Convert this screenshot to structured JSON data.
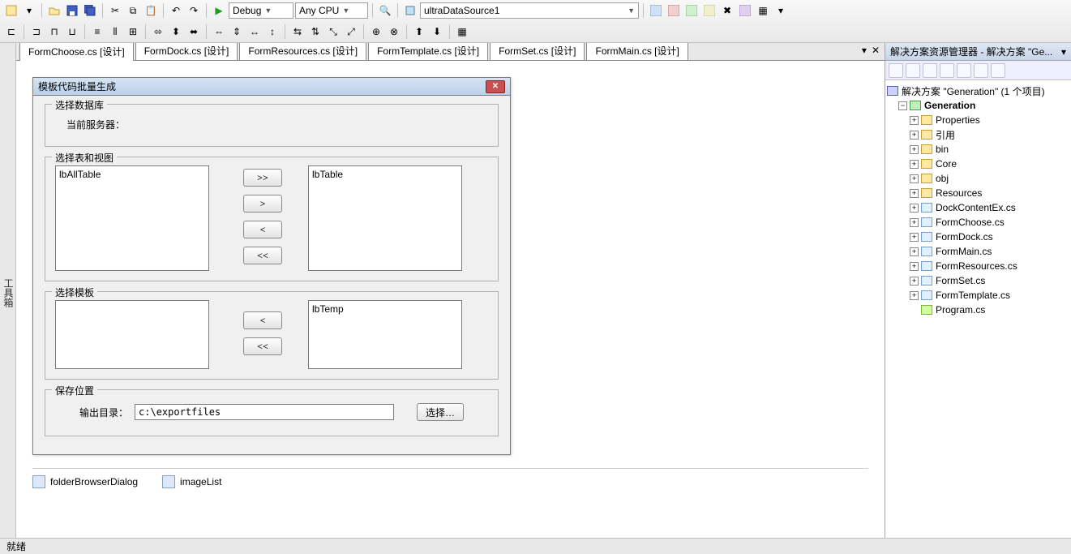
{
  "toolbar": {
    "config_combo": "Debug",
    "platform_combo": "Any CPU",
    "datasource_combo": "ultraDataSource1"
  },
  "left_strip_label": "工具箱",
  "tabs": [
    {
      "label": "FormChoose.cs [设计]",
      "active": true
    },
    {
      "label": "FormDock.cs [设计]",
      "active": false
    },
    {
      "label": "FormResources.cs [设计]",
      "active": false
    },
    {
      "label": "FormTemplate.cs [设计]",
      "active": false
    },
    {
      "label": "FormSet.cs [设计]",
      "active": false
    },
    {
      "label": "FormMain.cs [设计]",
      "active": false
    }
  ],
  "form": {
    "title": "模板代码批量生成",
    "group_db": "选择数据库",
    "label_server": "当前服务器：",
    "group_tables": "选择表和视图",
    "list_all_label": "lbAllTable",
    "list_sel_label": "lbTable",
    "btn_all_right": ">>",
    "btn_right": ">",
    "btn_left": "<",
    "btn_all_left": "<<",
    "group_template": "选择模板",
    "list_temp_label": "lbTemp",
    "group_save": "保存位置",
    "label_output": "输出目录：",
    "output_value": "c:\\exportfiles",
    "btn_browse": "选择…"
  },
  "tray": {
    "folder_dialog": "folderBrowserDialog",
    "image_list": "imageList"
  },
  "solution_panel": {
    "title": "解决方案资源管理器 - 解决方案 \"Ge...",
    "root": "解决方案 \"Generation\" (1 个项目)",
    "project": "Generation",
    "nodes": [
      {
        "label": "Properties",
        "icon": "fld"
      },
      {
        "label": "引用",
        "icon": "fld"
      },
      {
        "label": "bin",
        "icon": "fld"
      },
      {
        "label": "Core",
        "icon": "fld"
      },
      {
        "label": "obj",
        "icon": "fld"
      },
      {
        "label": "Resources",
        "icon": "fld"
      },
      {
        "label": "DockContentEx.cs",
        "icon": "file"
      },
      {
        "label": "FormChoose.cs",
        "icon": "file"
      },
      {
        "label": "FormDock.cs",
        "icon": "file"
      },
      {
        "label": "FormMain.cs",
        "icon": "file"
      },
      {
        "label": "FormResources.cs",
        "icon": "file"
      },
      {
        "label": "FormSet.cs",
        "icon": "file"
      },
      {
        "label": "FormTemplate.cs",
        "icon": "file"
      },
      {
        "label": "Program.cs",
        "icon": "cs"
      }
    ]
  },
  "status": "就绪"
}
